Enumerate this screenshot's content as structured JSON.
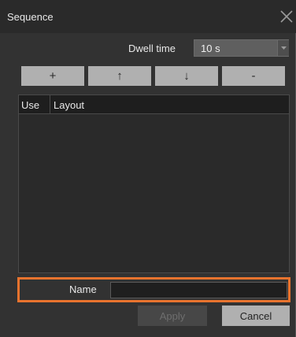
{
  "window": {
    "title": "Sequence",
    "close_icon": "close-icon"
  },
  "dwell": {
    "label": "Dwell time",
    "value": "10 s",
    "dropdown_icon": "chevron-down-icon"
  },
  "toolbar": {
    "add_label": "+",
    "move_up_label": "↑",
    "move_down_label": "↓",
    "remove_label": "-"
  },
  "list": {
    "columns": [
      "Use",
      "Layout"
    ],
    "rows": []
  },
  "name_field": {
    "label": "Name",
    "value": ""
  },
  "actions": {
    "apply_label": "Apply",
    "apply_enabled": false,
    "cancel_label": "Cancel"
  },
  "colors": {
    "background": "#323232",
    "titlebar": "#2a2a2a",
    "button": "#b0b0b0",
    "highlight": "#e8732e"
  }
}
